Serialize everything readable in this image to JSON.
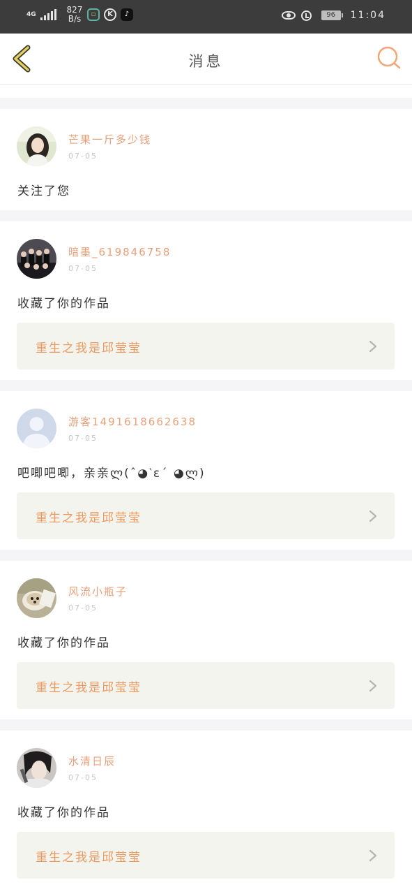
{
  "status_bar": {
    "network": "4G",
    "speed": "827 B/s",
    "battery": "96",
    "time": "11:04",
    "icons": [
      "signal-icon",
      "app-icon-green",
      "k-app-icon",
      "tiktok-icon",
      "eye-icon",
      "alarm-icon",
      "battery-icon"
    ]
  },
  "nav": {
    "title": "消息",
    "icons": [
      "back-chevron-icon",
      "search-icon"
    ]
  },
  "colors": {
    "accent": "#f0a777",
    "username": "#e8a07a",
    "date": "#c5c5c5",
    "separator": "#f5f4f6",
    "link_bg": "#f4f4ee",
    "back_icon": "#d7c14c"
  },
  "messages": [
    {
      "user": "芒果一斤多少钱",
      "date": "07-05",
      "text": "关注了您",
      "avatar_icon": "avatar-girl"
    },
    {
      "user": "暗墨_619846758",
      "date": "07-05",
      "text": "收藏了你的作品",
      "work": "重生之我是邱莹莹",
      "avatar_icon": "avatar-group"
    },
    {
      "user": "游客1491618662638",
      "date": "07-05",
      "text": "吧唧吧唧，亲亲ლ(ˆ◕‵ε´ ◕ლ)",
      "work": "重生之我是邱莹莹",
      "avatar_icon": "avatar-default"
    },
    {
      "user": "风流小瓶子",
      "date": "07-05",
      "text": "收藏了你的作品",
      "work": "重生之我是邱莹莹",
      "avatar_icon": "avatar-hedgehog"
    },
    {
      "user": "水清日辰",
      "date": "07-05",
      "text": "收藏了你的作品",
      "work": "重生之我是邱莹莹",
      "avatar_icon": "avatar-man"
    }
  ]
}
